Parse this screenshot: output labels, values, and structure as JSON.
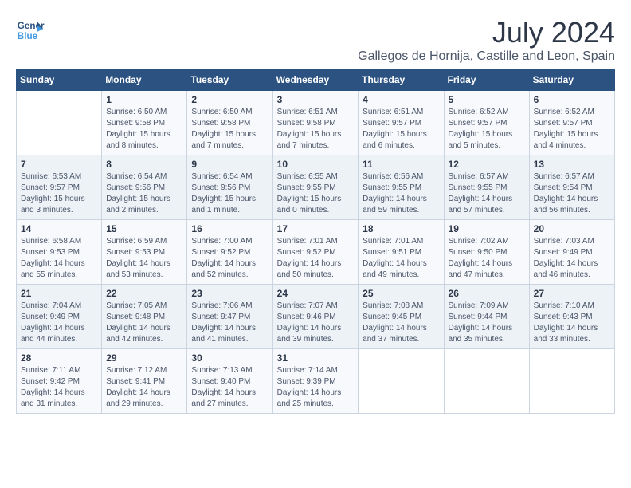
{
  "logo": {
    "line1": "General",
    "line2": "Blue"
  },
  "title": "July 2024",
  "location": "Gallegos de Hornija, Castille and Leon, Spain",
  "headers": [
    "Sunday",
    "Monday",
    "Tuesday",
    "Wednesday",
    "Thursday",
    "Friday",
    "Saturday"
  ],
  "weeks": [
    [
      {
        "day": "",
        "sunrise": "",
        "sunset": "",
        "daylight": ""
      },
      {
        "day": "1",
        "sunrise": "Sunrise: 6:50 AM",
        "sunset": "Sunset: 9:58 PM",
        "daylight": "Daylight: 15 hours and 8 minutes."
      },
      {
        "day": "2",
        "sunrise": "Sunrise: 6:50 AM",
        "sunset": "Sunset: 9:58 PM",
        "daylight": "Daylight: 15 hours and 7 minutes."
      },
      {
        "day": "3",
        "sunrise": "Sunrise: 6:51 AM",
        "sunset": "Sunset: 9:58 PM",
        "daylight": "Daylight: 15 hours and 7 minutes."
      },
      {
        "day": "4",
        "sunrise": "Sunrise: 6:51 AM",
        "sunset": "Sunset: 9:57 PM",
        "daylight": "Daylight: 15 hours and 6 minutes."
      },
      {
        "day": "5",
        "sunrise": "Sunrise: 6:52 AM",
        "sunset": "Sunset: 9:57 PM",
        "daylight": "Daylight: 15 hours and 5 minutes."
      },
      {
        "day": "6",
        "sunrise": "Sunrise: 6:52 AM",
        "sunset": "Sunset: 9:57 PM",
        "daylight": "Daylight: 15 hours and 4 minutes."
      }
    ],
    [
      {
        "day": "7",
        "sunrise": "Sunrise: 6:53 AM",
        "sunset": "Sunset: 9:57 PM",
        "daylight": "Daylight: 15 hours and 3 minutes."
      },
      {
        "day": "8",
        "sunrise": "Sunrise: 6:54 AM",
        "sunset": "Sunset: 9:56 PM",
        "daylight": "Daylight: 15 hours and 2 minutes."
      },
      {
        "day": "9",
        "sunrise": "Sunrise: 6:54 AM",
        "sunset": "Sunset: 9:56 PM",
        "daylight": "Daylight: 15 hours and 1 minute."
      },
      {
        "day": "10",
        "sunrise": "Sunrise: 6:55 AM",
        "sunset": "Sunset: 9:55 PM",
        "daylight": "Daylight: 15 hours and 0 minutes."
      },
      {
        "day": "11",
        "sunrise": "Sunrise: 6:56 AM",
        "sunset": "Sunset: 9:55 PM",
        "daylight": "Daylight: 14 hours and 59 minutes."
      },
      {
        "day": "12",
        "sunrise": "Sunrise: 6:57 AM",
        "sunset": "Sunset: 9:55 PM",
        "daylight": "Daylight: 14 hours and 57 minutes."
      },
      {
        "day": "13",
        "sunrise": "Sunrise: 6:57 AM",
        "sunset": "Sunset: 9:54 PM",
        "daylight": "Daylight: 14 hours and 56 minutes."
      }
    ],
    [
      {
        "day": "14",
        "sunrise": "Sunrise: 6:58 AM",
        "sunset": "Sunset: 9:53 PM",
        "daylight": "Daylight: 14 hours and 55 minutes."
      },
      {
        "day": "15",
        "sunrise": "Sunrise: 6:59 AM",
        "sunset": "Sunset: 9:53 PM",
        "daylight": "Daylight: 14 hours and 53 minutes."
      },
      {
        "day": "16",
        "sunrise": "Sunrise: 7:00 AM",
        "sunset": "Sunset: 9:52 PM",
        "daylight": "Daylight: 14 hours and 52 minutes."
      },
      {
        "day": "17",
        "sunrise": "Sunrise: 7:01 AM",
        "sunset": "Sunset: 9:52 PM",
        "daylight": "Daylight: 14 hours and 50 minutes."
      },
      {
        "day": "18",
        "sunrise": "Sunrise: 7:01 AM",
        "sunset": "Sunset: 9:51 PM",
        "daylight": "Daylight: 14 hours and 49 minutes."
      },
      {
        "day": "19",
        "sunrise": "Sunrise: 7:02 AM",
        "sunset": "Sunset: 9:50 PM",
        "daylight": "Daylight: 14 hours and 47 minutes."
      },
      {
        "day": "20",
        "sunrise": "Sunrise: 7:03 AM",
        "sunset": "Sunset: 9:49 PM",
        "daylight": "Daylight: 14 hours and 46 minutes."
      }
    ],
    [
      {
        "day": "21",
        "sunrise": "Sunrise: 7:04 AM",
        "sunset": "Sunset: 9:49 PM",
        "daylight": "Daylight: 14 hours and 44 minutes."
      },
      {
        "day": "22",
        "sunrise": "Sunrise: 7:05 AM",
        "sunset": "Sunset: 9:48 PM",
        "daylight": "Daylight: 14 hours and 42 minutes."
      },
      {
        "day": "23",
        "sunrise": "Sunrise: 7:06 AM",
        "sunset": "Sunset: 9:47 PM",
        "daylight": "Daylight: 14 hours and 41 minutes."
      },
      {
        "day": "24",
        "sunrise": "Sunrise: 7:07 AM",
        "sunset": "Sunset: 9:46 PM",
        "daylight": "Daylight: 14 hours and 39 minutes."
      },
      {
        "day": "25",
        "sunrise": "Sunrise: 7:08 AM",
        "sunset": "Sunset: 9:45 PM",
        "daylight": "Daylight: 14 hours and 37 minutes."
      },
      {
        "day": "26",
        "sunrise": "Sunrise: 7:09 AM",
        "sunset": "Sunset: 9:44 PM",
        "daylight": "Daylight: 14 hours and 35 minutes."
      },
      {
        "day": "27",
        "sunrise": "Sunrise: 7:10 AM",
        "sunset": "Sunset: 9:43 PM",
        "daylight": "Daylight: 14 hours and 33 minutes."
      }
    ],
    [
      {
        "day": "28",
        "sunrise": "Sunrise: 7:11 AM",
        "sunset": "Sunset: 9:42 PM",
        "daylight": "Daylight: 14 hours and 31 minutes."
      },
      {
        "day": "29",
        "sunrise": "Sunrise: 7:12 AM",
        "sunset": "Sunset: 9:41 PM",
        "daylight": "Daylight: 14 hours and 29 minutes."
      },
      {
        "day": "30",
        "sunrise": "Sunrise: 7:13 AM",
        "sunset": "Sunset: 9:40 PM",
        "daylight": "Daylight: 14 hours and 27 minutes."
      },
      {
        "day": "31",
        "sunrise": "Sunrise: 7:14 AM",
        "sunset": "Sunset: 9:39 PM",
        "daylight": "Daylight: 14 hours and 25 minutes."
      },
      {
        "day": "",
        "sunrise": "",
        "sunset": "",
        "daylight": ""
      },
      {
        "day": "",
        "sunrise": "",
        "sunset": "",
        "daylight": ""
      },
      {
        "day": "",
        "sunrise": "",
        "sunset": "",
        "daylight": ""
      }
    ]
  ]
}
